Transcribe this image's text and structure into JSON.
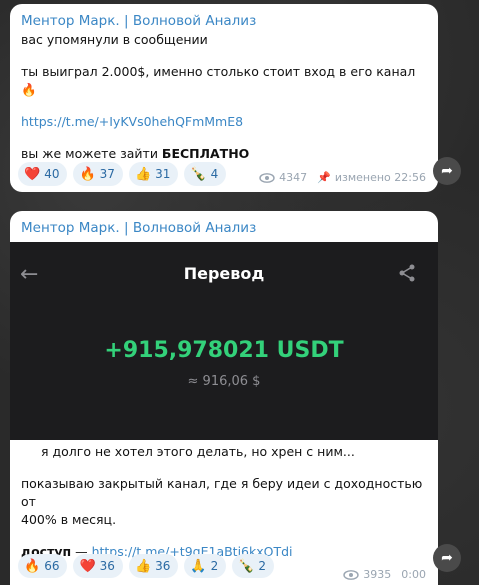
{
  "messages": [
    {
      "sender": "Ментор Марк. | Волновой Анализ",
      "lines": [
        "вас упомянули в сообщении",
        "",
        "ты выиграл 2.000$, именно столько стоит вход в его канал 🔥",
        "",
        "https://t.me/+IyKVs0hehQFmMmE8",
        "",
        "вы же можете зайти БЕСПЛАТНО"
      ],
      "reactions": [
        {
          "emoji": "❤️",
          "count": "40"
        },
        {
          "emoji": "🔥",
          "count": "37"
        },
        {
          "emoji": "👍",
          "count": "31"
        },
        {
          "emoji": "🍾",
          "count": "4"
        }
      ],
      "views": "4347",
      "edited": "изменено 22:56"
    },
    {
      "sender": "Ментор Марк. | Волновой Анализ",
      "transfer": {
        "title": "Перевод",
        "amount": "+915,978021 USDT",
        "approx": "≈ 916,06 $"
      },
      "lines": [
        "я долго не хотел этого делать, но хрен с ним...",
        "",
        "показываю закрытый канал, где я беру идеи с доходностью от",
        "400% в месяц.",
        "",
        "доступ — https://t.me/+t9qE1aBti6kxOTdi"
      ],
      "reactions": [
        {
          "emoji": "🔥",
          "count": "66"
        },
        {
          "emoji": "❤️",
          "count": "36"
        },
        {
          "emoji": "👍",
          "count": "36"
        },
        {
          "emoji": "🙏",
          "count": "2"
        },
        {
          "emoji": "🍾",
          "count": "2"
        }
      ],
      "views": "3935",
      "time": "0:00"
    }
  ]
}
